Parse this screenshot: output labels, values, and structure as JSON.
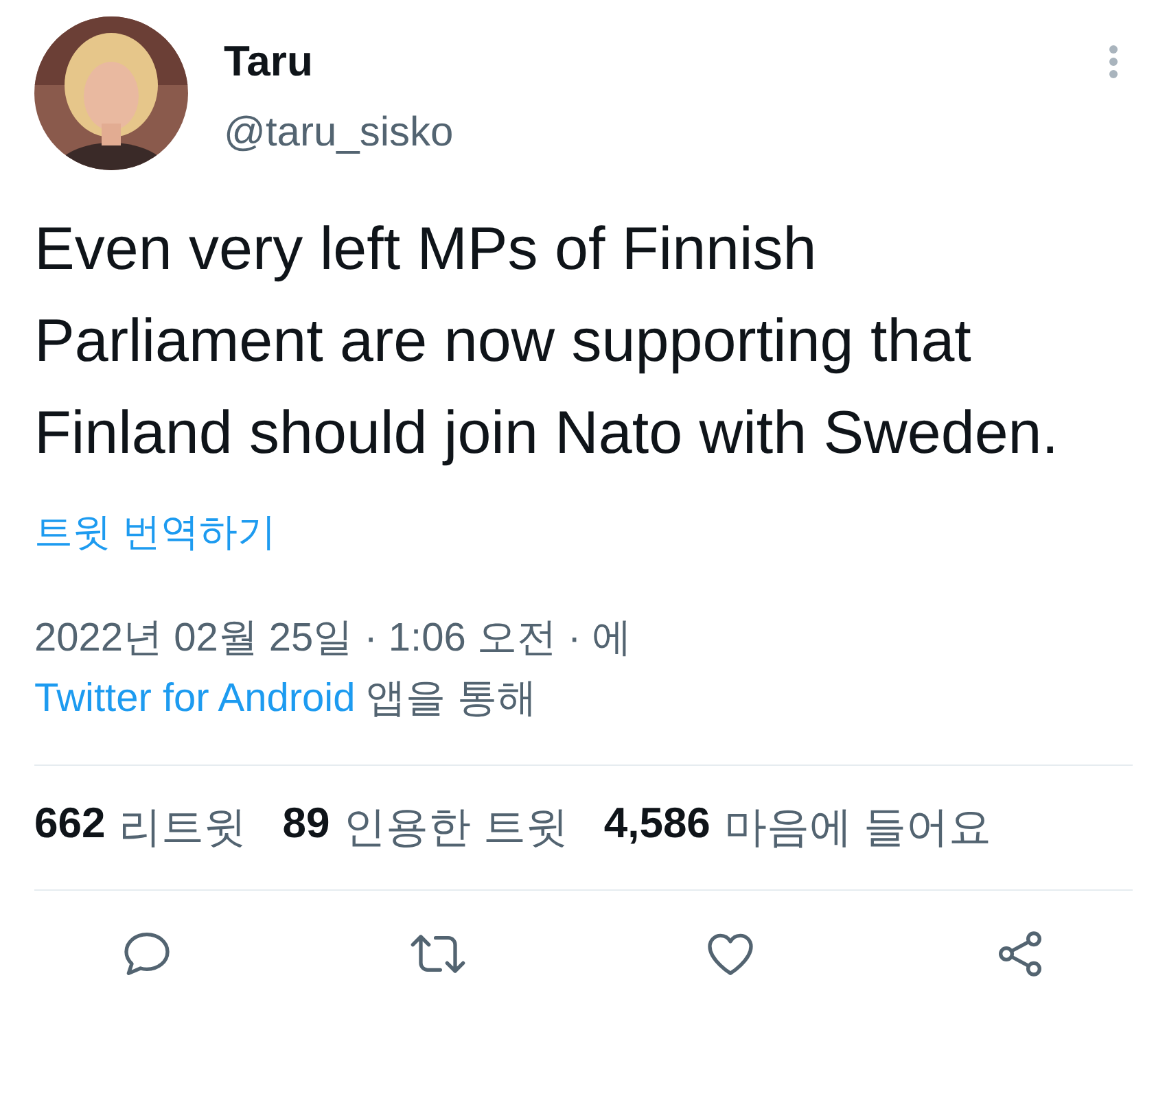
{
  "author": {
    "name": "Taru",
    "handle": "@taru_sisko"
  },
  "text": "Even very left MPs of Finnish Parliament are now supporting that Finland should join Nato with Sweden.",
  "translate_link": "트윗 번역하기",
  "timestamp": "2022년 02월 25일 · 1:06 오전 · 에",
  "source": {
    "app": "Twitter for Android",
    "suffix": "앱을 통해"
  },
  "stats": [
    {
      "count": "662",
      "label": "리트윗"
    },
    {
      "count": "89",
      "label": "인용한 트윗"
    },
    {
      "count": "4,586",
      "label": "마음에 들어요"
    }
  ],
  "actions": [
    {
      "kind": "reply"
    },
    {
      "kind": "retweet"
    },
    {
      "kind": "like"
    },
    {
      "kind": "share"
    }
  ]
}
